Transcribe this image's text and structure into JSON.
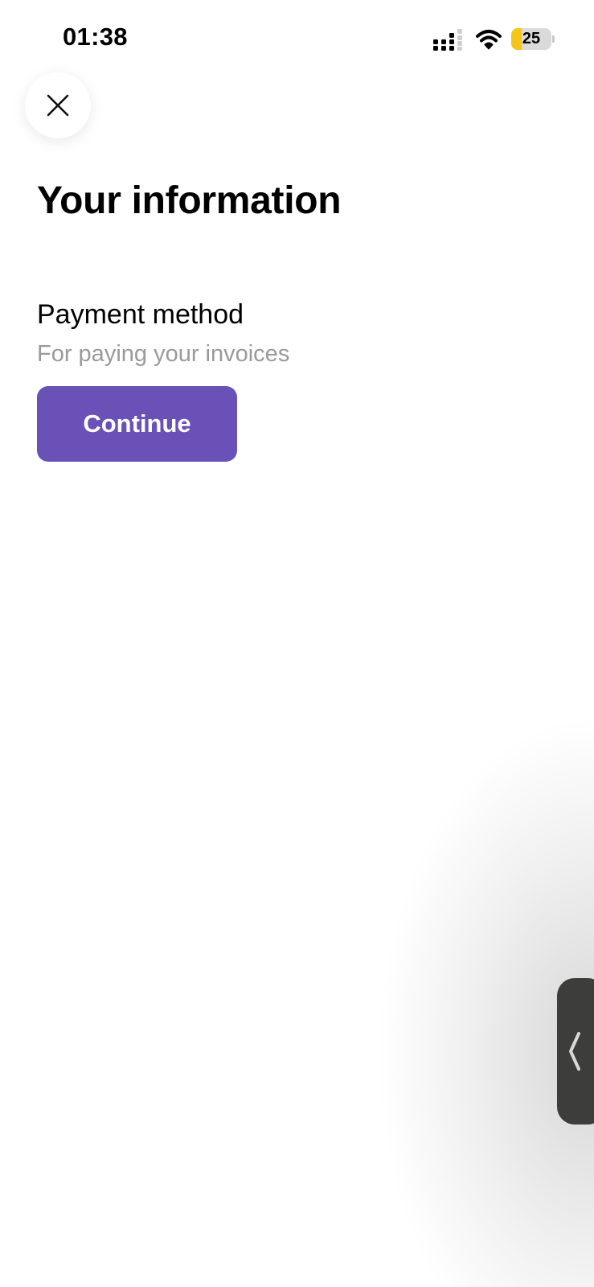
{
  "status_bar": {
    "time": "01:38",
    "battery_level": "25",
    "battery_fraction": 0.25,
    "icons": [
      "signal-icon",
      "wifi-icon",
      "battery-icon"
    ]
  },
  "header": {
    "close_icon": "close-icon"
  },
  "main": {
    "title": "Your information",
    "section": {
      "title": "Payment method",
      "subtitle": "For paying your invoices",
      "button_label": "Continue"
    }
  },
  "side_handle": {
    "icon": "chevron-left-icon"
  },
  "colors": {
    "accent": "#6951b8",
    "subtitle": "#9a9a9a",
    "battery_fill": "#f5c518",
    "handle": "#3d3d3b"
  }
}
